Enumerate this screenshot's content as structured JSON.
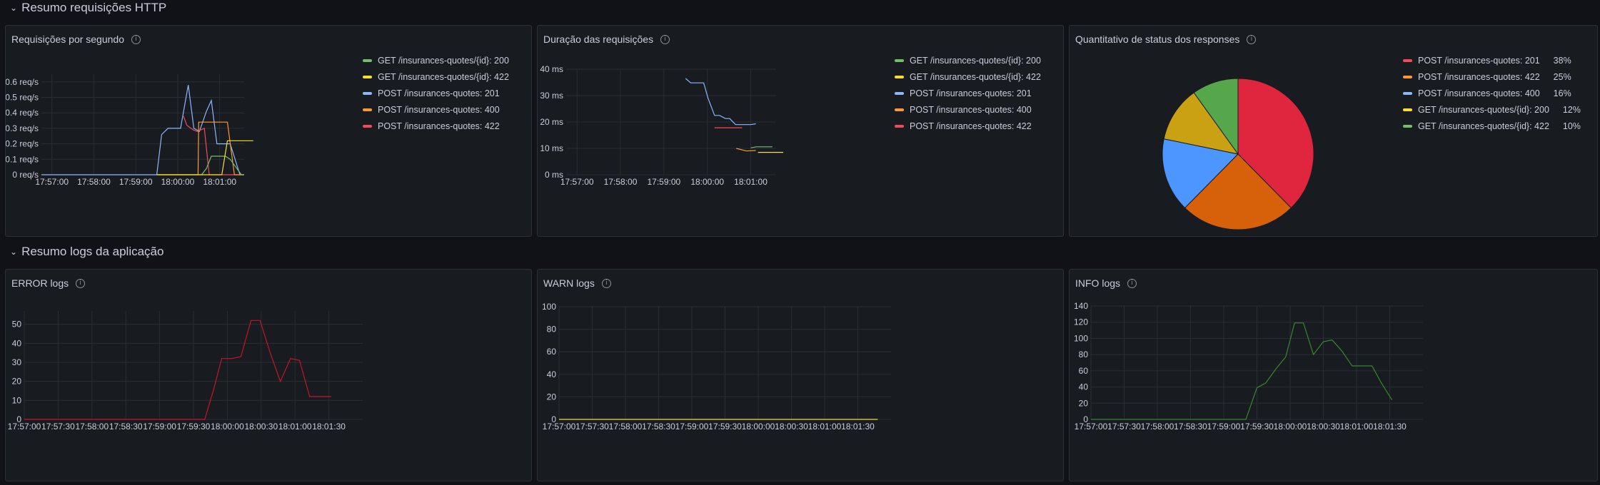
{
  "rows": [
    {
      "title": "Resumo requisições HTTP"
    },
    {
      "title": "Resumo logs da aplicação"
    }
  ],
  "colors": {
    "green": "#73bf69",
    "yellow": "#fade2a",
    "blue": "#8ab8ff",
    "orange": "#ff9830",
    "red": "#f2495c",
    "grid": "#2a2e35",
    "axisText": "#ccccdc"
  },
  "panels": {
    "requests": {
      "title": "Requisições por segundo",
      "info_icon": "info-icon",
      "legend": [
        {
          "label": "GET /insurances-quotes/{id}: 200",
          "color": "#73bf69"
        },
        {
          "label": "GET /insurances-quotes/{id}: 422",
          "color": "#fade2a"
        },
        {
          "label": "POST /insurances-quotes: 201",
          "color": "#8ab8ff"
        },
        {
          "label": "POST /insurances-quotes: 400",
          "color": "#ff9830"
        },
        {
          "label": "POST /insurances-quotes: 422",
          "color": "#f2495c"
        }
      ]
    },
    "duration": {
      "title": "Duração das requisições",
      "info_icon": "info-icon",
      "legend": [
        {
          "label": "GET /insurances-quotes/{id}: 200",
          "color": "#73bf69"
        },
        {
          "label": "GET /insurances-quotes/{id}: 422",
          "color": "#fade2a"
        },
        {
          "label": "POST /insurances-quotes: 201",
          "color": "#8ab8ff"
        },
        {
          "label": "POST /insurances-quotes: 400",
          "color": "#ff9830"
        },
        {
          "label": "POST /insurances-quotes: 422",
          "color": "#f2495c"
        }
      ]
    },
    "status": {
      "title": "Quantitativo de status dos responses",
      "info_icon": "info-icon",
      "legend": [
        {
          "label": "POST /insurances-quotes: 201",
          "pct": "38%",
          "color": "#f2495c"
        },
        {
          "label": "POST /insurances-quotes: 422",
          "pct": "25%",
          "color": "#ff9830"
        },
        {
          "label": "POST /insurances-quotes: 400",
          "pct": "16%",
          "color": "#8ab8ff"
        },
        {
          "label": "GET /insurances-quotes/{id}: 200",
          "pct": "12%",
          "color": "#fade2a"
        },
        {
          "label": "GET /insurances-quotes/{id}: 422",
          "pct": "10%",
          "color": "#73bf69"
        }
      ]
    },
    "error": {
      "title": "ERROR logs",
      "info_icon": "info-icon"
    },
    "warn": {
      "title": "WARN logs",
      "info_icon": "info-icon"
    },
    "info": {
      "title": "INFO logs",
      "info_icon": "info-icon"
    }
  },
  "chart_data": [
    {
      "id": "requests",
      "type": "line",
      "xlabel": "",
      "ylabel": "",
      "xlim": [
        0,
        290
      ],
      "ylim": [
        0,
        0.65
      ],
      "yticks": [
        0,
        0.1,
        0.2,
        0.3,
        0.4,
        0.5,
        0.6
      ],
      "ytick_labels": [
        "0 req/s",
        "0.1 req/s",
        "0.2 req/s",
        "0.3 req/s",
        "0.4 req/s",
        "0.5 req/s",
        "0.6 req/s"
      ],
      "xticks": [
        15,
        75,
        135,
        195,
        255
      ],
      "xtick_labels": [
        "17:57:00",
        "17:58:00",
        "17:59:00",
        "18:00:00",
        "18:01:00"
      ],
      "series": [
        {
          "color": "#8ab8ff",
          "points": [
            [
              0,
              0
            ],
            [
              165,
              0
            ],
            [
              172,
              0.26
            ],
            [
              181,
              0.3
            ],
            [
              199,
              0.3
            ],
            [
              210,
              0.58
            ],
            [
              218,
              0.3
            ],
            [
              226,
              0.28
            ],
            [
              236,
              0.41
            ],
            [
              243,
              0.48
            ],
            [
              251,
              0.2
            ],
            [
              270,
              0.2
            ],
            [
              284,
              0.0
            ],
            [
              290,
              0
            ]
          ]
        },
        {
          "color": "#f2495c",
          "points": [
            [
              203,
              0.38
            ],
            [
              208,
              0.32
            ],
            [
              217,
              0.29
            ],
            [
              223,
              0.28
            ],
            [
              233,
              0.3
            ],
            [
              240,
              0.0
            ],
            [
              290,
              0
            ]
          ]
        },
        {
          "color": "#ff9830",
          "points": [
            [
              165,
              0
            ],
            [
              224,
              0
            ],
            [
              225,
              0.34
            ],
            [
              232,
              0.34
            ],
            [
              266,
              0.34
            ],
            [
              276,
              0.0
            ],
            [
              290,
              0
            ]
          ]
        },
        {
          "color": "#73bf69",
          "points": [
            [
              165,
              0
            ],
            [
              229,
              0
            ],
            [
              236,
              0.04
            ],
            [
              243,
              0.12
            ],
            [
              263,
              0.12
            ],
            [
              270,
              0.1
            ],
            [
              286,
              0
            ],
            [
              290,
              0
            ]
          ]
        },
        {
          "color": "#fade2a",
          "points": [
            [
              165,
              0
            ],
            [
              258,
              0
            ],
            [
              266,
              0.22
            ],
            [
              303,
              0.22
            ]
          ]
        }
      ]
    },
    {
      "id": "duration",
      "type": "line",
      "xlabel": "",
      "ylabel": "",
      "xlim": [
        0,
        290
      ],
      "ylim": [
        0,
        40
      ],
      "yticks": [
        0,
        10,
        20,
        30,
        40
      ],
      "ytick_labels": [
        "0 ms",
        "10 ms",
        "20 ms",
        "30 ms",
        "40 ms"
      ],
      "xticks": [
        15,
        75,
        135,
        195,
        255
      ],
      "xtick_labels": [
        "17:57:00",
        "17:58:00",
        "17:59:00",
        "18:00:00",
        "18:01:00"
      ],
      "series": [
        {
          "color": "#8ab8ff",
          "points": [
            [
              165,
              36.5
            ],
            [
              172,
              34.8
            ],
            [
              181,
              34.8
            ],
            [
              190,
              34.8
            ],
            [
              196,
              29
            ],
            [
              205,
              22.5
            ],
            [
              212,
              22.5
            ],
            [
              220,
              21.3
            ],
            [
              226,
              21.3
            ],
            [
              234,
              19
            ],
            [
              255,
              19
            ],
            [
              262,
              19.3
            ]
          ]
        },
        {
          "color": "#f2495c",
          "points": [
            [
              205,
              17.8
            ],
            [
              243,
              17.8
            ]
          ]
        },
        {
          "color": "#ff9830",
          "points": [
            [
              235,
              10
            ],
            [
              249,
              9
            ],
            [
              262,
              9.2
            ]
          ]
        },
        {
          "color": "#73bf69",
          "points": [
            [
              255,
              10.2
            ],
            [
              263,
              10.6
            ],
            [
              285,
              10.6
            ]
          ]
        },
        {
          "color": "#fade2a",
          "points": [
            [
              265,
              8.5
            ],
            [
              300,
              8.5
            ]
          ]
        }
      ]
    },
    {
      "id": "status",
      "type": "pie",
      "categories": [
        "POST /insurances-quotes: 201",
        "POST /insurances-quotes: 422",
        "POST /insurances-quotes: 400",
        "GET /insurances-quotes/{id}: 200",
        "GET /insurances-quotes/{id}: 422"
      ],
      "values": [
        38,
        25,
        16,
        12,
        10
      ],
      "colors": [
        "#e0253f",
        "#d6610a",
        "#4d96ff",
        "#c9a112",
        "#56a64b"
      ]
    },
    {
      "id": "error",
      "type": "line",
      "xlabel": "",
      "ylabel": "",
      "xlim": [
        0,
        300
      ],
      "ylim": [
        0,
        57
      ],
      "yticks": [
        0,
        10,
        20,
        30,
        40,
        50
      ],
      "ytick_labels": [
        "0",
        "10",
        "20",
        "30",
        "40",
        "50"
      ],
      "xticks": [
        0,
        30,
        60,
        90,
        120,
        150,
        180,
        210,
        240,
        270
      ],
      "xtick_labels": [
        "17:57:00",
        "17:57:30",
        "17:58:00",
        "17:58:30",
        "17:59:00",
        "17:59:30",
        "18:00:00",
        "18:00:30",
        "18:01:00",
        "18:01:30"
      ],
      "series": [
        {
          "color": "#c4162a",
          "points": [
            [
              0,
              0
            ],
            [
              160,
              0
            ],
            [
              168,
              16
            ],
            [
              175,
              32
            ],
            [
              184,
              32
            ],
            [
              192,
              33
            ],
            [
              201,
              52
            ],
            [
              209,
              52
            ],
            [
              218,
              35
            ],
            [
              227,
              20
            ],
            [
              236,
              32
            ],
            [
              244,
              31
            ],
            [
              253,
              12
            ],
            [
              272,
              12
            ]
          ]
        }
      ]
    },
    {
      "id": "warn",
      "type": "line",
      "xlabel": "",
      "ylabel": "",
      "xlim": [
        0,
        300
      ],
      "ylim": [
        0,
        100
      ],
      "yticks": [
        0,
        20,
        40,
        60,
        80,
        100
      ],
      "ytick_labels": [
        "0",
        "20",
        "40",
        "60",
        "80",
        "100"
      ],
      "xticks": [
        0,
        30,
        60,
        90,
        120,
        150,
        180,
        210,
        240,
        270
      ],
      "xtick_labels": [
        "17:57:00",
        "17:57:30",
        "17:58:00",
        "17:58:30",
        "17:59:00",
        "17:59:30",
        "18:00:00",
        "18:00:30",
        "18:01:00",
        "18:01:30"
      ],
      "series": [
        {
          "color": "#fade2a",
          "points": [
            [
              0,
              0
            ],
            [
              288,
              0
            ]
          ]
        }
      ]
    },
    {
      "id": "info",
      "type": "line",
      "xlabel": "",
      "ylabel": "",
      "xlim": [
        0,
        300
      ],
      "ylim": [
        0,
        140
      ],
      "yticks": [
        0,
        20,
        40,
        60,
        80,
        100,
        120,
        140
      ],
      "ytick_labels": [
        "0",
        "20",
        "40",
        "60",
        "80",
        "100",
        "120",
        "140"
      ],
      "xticks": [
        0,
        30,
        60,
        90,
        120,
        150,
        180,
        210,
        240,
        270
      ],
      "xtick_labels": [
        "17:57:00",
        "17:57:30",
        "17:58:00",
        "17:58:30",
        "17:59:00",
        "17:59:30",
        "18:00:00",
        "18:00:30",
        "18:01:00",
        "18:01:30"
      ],
      "series": [
        {
          "color": "#37872d",
          "points": [
            [
              0,
              0
            ],
            [
              140,
              0
            ],
            [
              150,
              39
            ],
            [
              158,
              45
            ],
            [
              167,
              62
            ],
            [
              176,
              77
            ],
            [
              184,
              119
            ],
            [
              192,
              119
            ],
            [
              201,
              80
            ],
            [
              210,
              96
            ],
            [
              218,
              98
            ],
            [
              227,
              84
            ],
            [
              236,
              66
            ],
            [
              254,
              66
            ],
            [
              262,
              46
            ],
            [
              272,
              24
            ]
          ]
        }
      ]
    }
  ]
}
